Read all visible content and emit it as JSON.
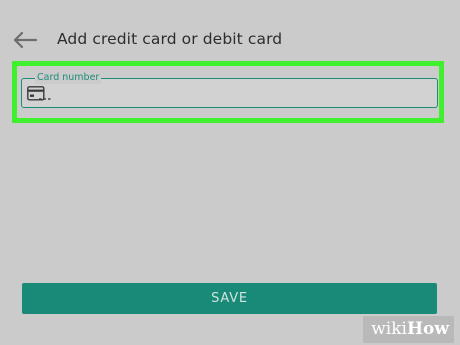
{
  "header": {
    "back_icon": "arrow-left-icon",
    "title": "Add credit card or debit card"
  },
  "card_field": {
    "label": "Card number",
    "value": "",
    "icon": "credit-card-icon"
  },
  "actions": {
    "save_label": "SAVE"
  },
  "watermark": {
    "part1": "wiki",
    "part2": "How"
  },
  "colors": {
    "background": "#cbcbcb",
    "accent": "#1f8b7a",
    "save_button": "#1a8a78",
    "highlight": "#3ff02f"
  }
}
